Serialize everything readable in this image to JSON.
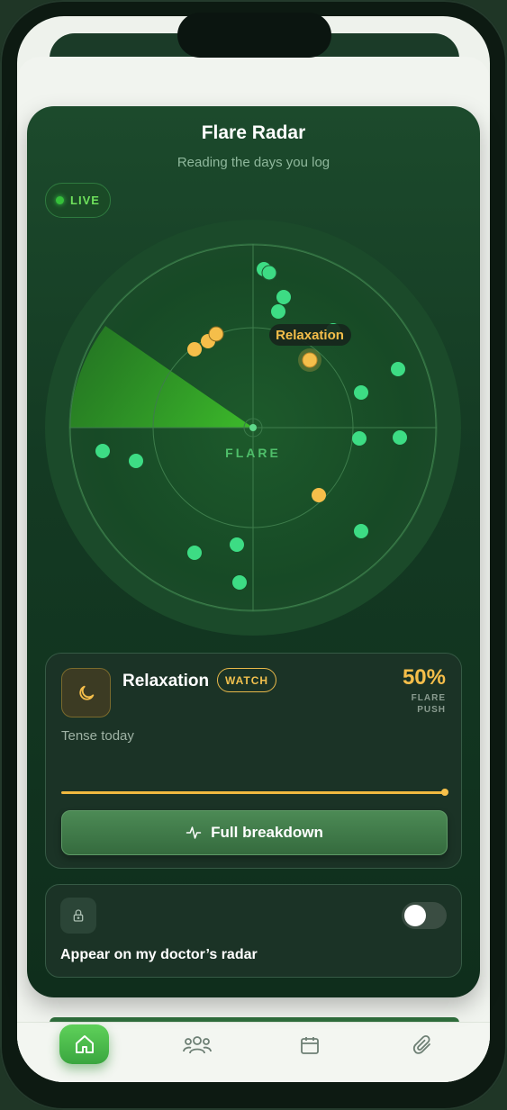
{
  "panel": {
    "title": "Flare Radar",
    "subtitle": "Reading the days you log",
    "live_label": "LIVE"
  },
  "radar": {
    "center_label": "FLARE",
    "highlight_label": "Relaxation",
    "colors": {
      "safe": "#3ddc84",
      "watch": "#f5be4a",
      "sweep": "#2fa12a",
      "background": "#174a26"
    }
  },
  "factor_card": {
    "name": "Relaxation",
    "badge": "WATCH",
    "percent": "50%",
    "percent_caption_line1": "FLARE",
    "percent_caption_line2": "PUSH",
    "status": "Tense today",
    "progress": 1.0,
    "button_label": "Full breakdown",
    "icon": "moon-icon"
  },
  "privacy_card": {
    "label": "Appear on my doctor’s radar",
    "toggle_on": false,
    "icon": "lock-icon"
  },
  "tabbar": {
    "tabs": [
      {
        "icon": "home-icon",
        "active": true
      },
      {
        "icon": "people-icon",
        "active": false
      },
      {
        "icon": "calendar-icon",
        "active": false
      },
      {
        "icon": "paperclip-icon",
        "active": false
      }
    ]
  }
}
